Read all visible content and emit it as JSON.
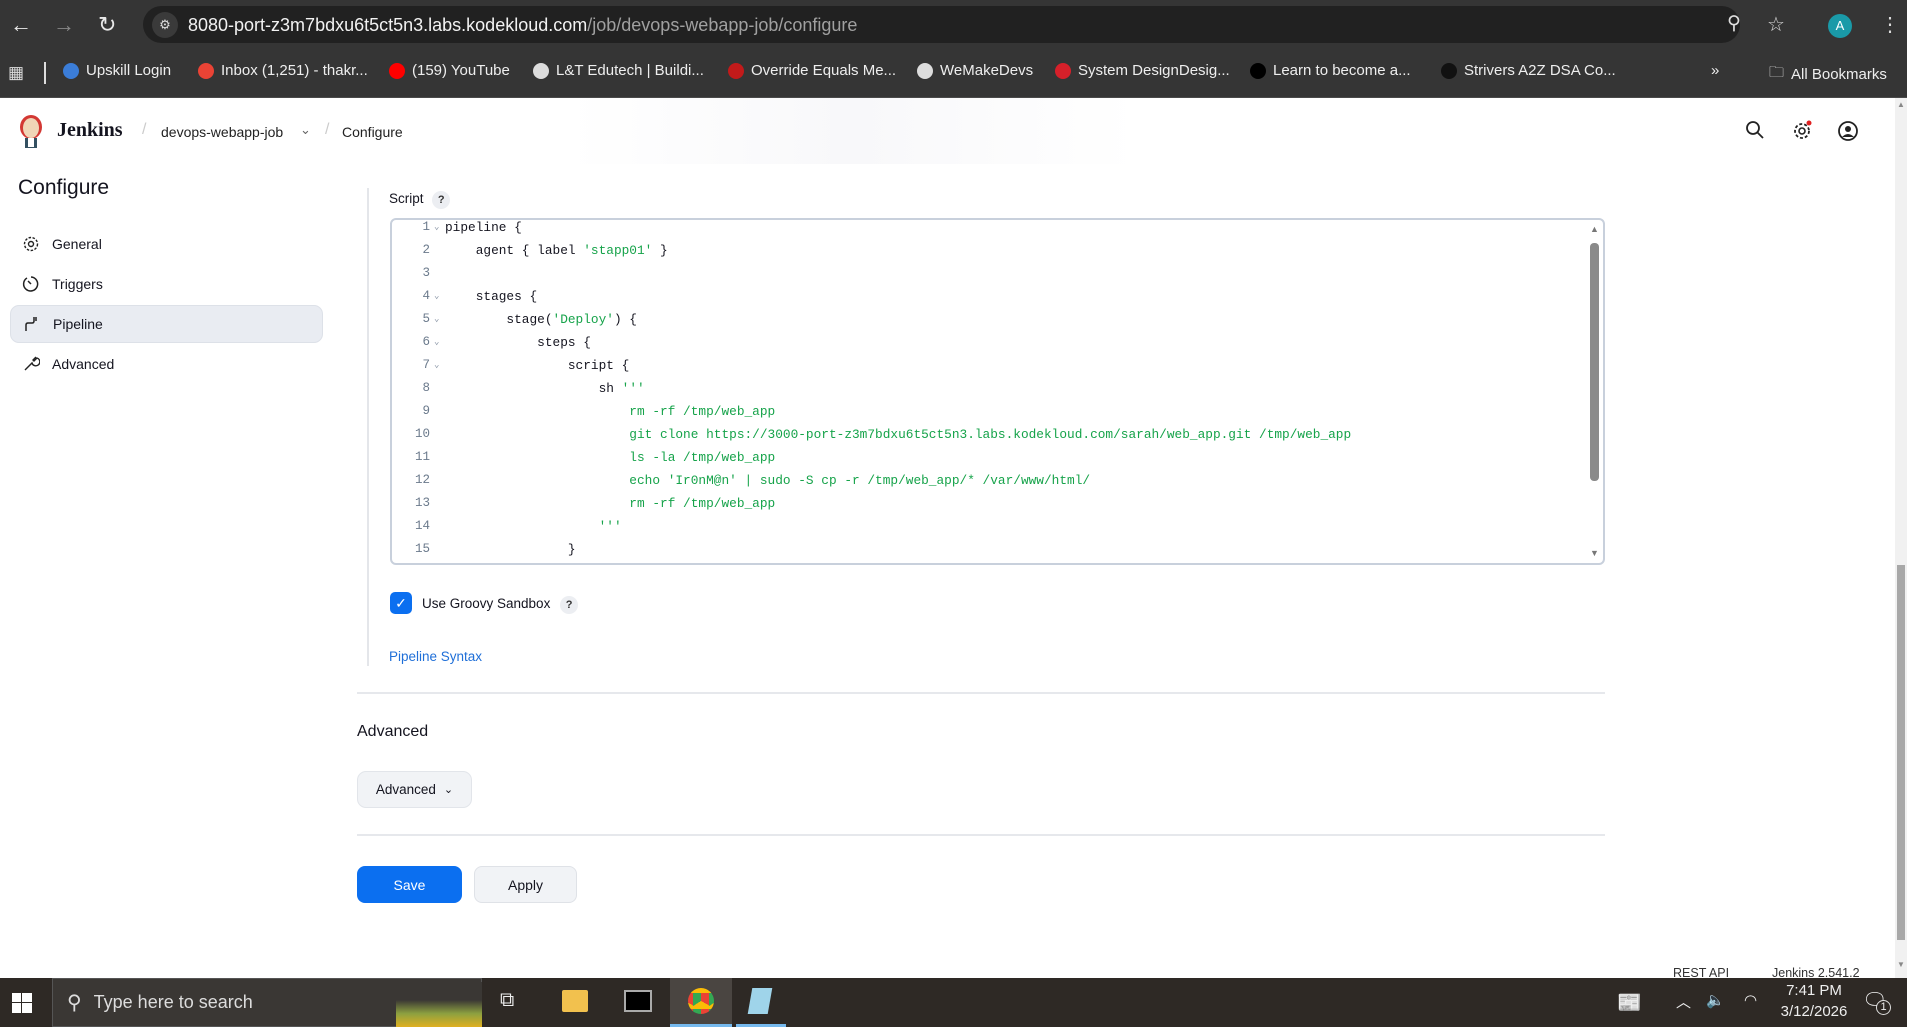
{
  "browser": {
    "url_host": "8080-port-z3m7bdxu6t5ct5n3.labs.kodekloud.com",
    "url_path": "/job/devops-webapp-job/configure",
    "profile_initial": "A",
    "bookmarks": [
      {
        "label": "Upskill Login",
        "color": "#3b7dd8"
      },
      {
        "label": "Inbox (1,251) - thakr...",
        "color": "#ea4335"
      },
      {
        "label": "(159) YouTube",
        "color": "#ff0000"
      },
      {
        "label": "L&T Edutech | Buildi...",
        "color": "#dddddd"
      },
      {
        "label": "Override Equals Me...",
        "color": "#c21a1a"
      },
      {
        "label": "WeMakeDevs",
        "color": "#dddddd"
      },
      {
        "label": "System DesignDesig...",
        "color": "#d6202a"
      },
      {
        "label": "Learn to become a...",
        "color": "#000000"
      },
      {
        "label": "Strivers A2Z DSA Co...",
        "color": "#111111"
      }
    ],
    "more": "»",
    "all_bookmarks": "All Bookmarks"
  },
  "header": {
    "brand": "Jenkins",
    "breadcrumb": [
      "devops-webapp-job",
      "Configure"
    ]
  },
  "sidebar": {
    "title": "Configure",
    "items": [
      {
        "label": "General",
        "icon": "gear-icon"
      },
      {
        "label": "Triggers",
        "icon": "clock-icon"
      },
      {
        "label": "Pipeline",
        "icon": "pipeline-icon",
        "active": true
      },
      {
        "label": "Advanced",
        "icon": "wrench-icon"
      }
    ]
  },
  "script": {
    "label": "Script",
    "help": "?",
    "lines": [
      {
        "n": "1",
        "fold": true,
        "segs": [
          [
            "pipeline {",
            "plain"
          ]
        ]
      },
      {
        "n": "2",
        "fold": false,
        "segs": [
          [
            "    agent { label ",
            "plain"
          ],
          [
            "'stapp01'",
            "str"
          ],
          [
            " }",
            "plain"
          ]
        ]
      },
      {
        "n": "3",
        "fold": false,
        "segs": []
      },
      {
        "n": "4",
        "fold": true,
        "segs": [
          [
            "    stages {",
            "plain"
          ]
        ]
      },
      {
        "n": "5",
        "fold": true,
        "segs": [
          [
            "        stage(",
            "plain"
          ],
          [
            "'Deploy'",
            "str"
          ],
          [
            ") {",
            "plain"
          ]
        ]
      },
      {
        "n": "6",
        "fold": true,
        "segs": [
          [
            "            steps {",
            "plain"
          ]
        ]
      },
      {
        "n": "7",
        "fold": true,
        "segs": [
          [
            "                script {",
            "plain"
          ]
        ]
      },
      {
        "n": "8",
        "fold": false,
        "segs": [
          [
            "                    sh ",
            "plain"
          ],
          [
            "'''",
            "str"
          ]
        ]
      },
      {
        "n": "9",
        "fold": false,
        "segs": [
          [
            "                        rm -rf /tmp/web_app",
            "str"
          ]
        ]
      },
      {
        "n": "10",
        "fold": false,
        "segs": [
          [
            "                        git clone https://3000-port-z3m7bdxu6t5ct5n3.labs.kodekloud.com/sarah/web_app.git /tmp/web_app",
            "str"
          ]
        ]
      },
      {
        "n": "11",
        "fold": false,
        "segs": [
          [
            "                        ls -la /tmp/web_app",
            "str"
          ]
        ]
      },
      {
        "n": "12",
        "fold": false,
        "segs": [
          [
            "                        echo 'Ir0nM@n' | sudo -S cp -r /tmp/web_app/* /var/www/html/",
            "str"
          ]
        ]
      },
      {
        "n": "13",
        "fold": false,
        "segs": [
          [
            "                        rm -rf /tmp/web_app",
            "str"
          ]
        ]
      },
      {
        "n": "14",
        "fold": false,
        "segs": [
          [
            "                    '''",
            "str"
          ]
        ]
      },
      {
        "n": "15",
        "fold": false,
        "segs": [
          [
            "                }",
            "plain"
          ]
        ]
      }
    ]
  },
  "sandbox": {
    "label": "Use Groovy Sandbox",
    "checked": true,
    "help": "?"
  },
  "pipeline_syntax": "Pipeline Syntax",
  "advanced": {
    "heading": "Advanced",
    "button": "Advanced"
  },
  "actions": {
    "save": "Save",
    "apply": "Apply"
  },
  "footer": {
    "rest_api": "REST API",
    "version": "Jenkins 2.541.2"
  },
  "taskbar": {
    "search_placeholder": "Type here to search",
    "time": "7:41 PM",
    "date": "3/12/2026",
    "notifications": "1"
  }
}
